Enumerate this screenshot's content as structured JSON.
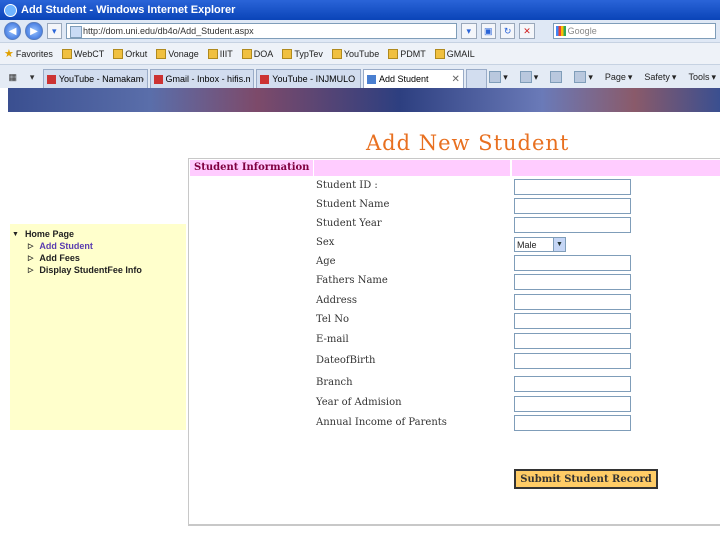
{
  "window": {
    "title": "Add Student - Windows Internet Explorer"
  },
  "address_bar": {
    "url": "http://dom.uni.edu/db4o/Add_Student.aspx",
    "search_placeholder": "Google"
  },
  "favorites_bar": {
    "favorites_label": "Favorites",
    "items": [
      "WebCT",
      "Orkut",
      "Vonage",
      "IIIT",
      "DOA",
      "TypTev",
      "YouTube",
      "PDMT",
      "GMAIL"
    ]
  },
  "tabs": [
    {
      "label": "YouTube - Namakame ...",
      "active": false
    },
    {
      "label": "Gmail - Inbox - hifis.m...",
      "active": false
    },
    {
      "label": "YouTube - INJMULO H...",
      "active": false
    },
    {
      "label": "Add Student",
      "active": true
    }
  ],
  "command_bar": {
    "page": "Page",
    "safety": "Safety",
    "tools": "Tools"
  },
  "page": {
    "heading": "Add New Student",
    "sidebar": {
      "root": "Home Page",
      "items": [
        "Add Student",
        "Add Fees",
        "Display StudentFee Info"
      ]
    },
    "form": {
      "section_title": "Student Information",
      "fields": [
        "Student ID :",
        "Student Name",
        "Student Year",
        "Sex",
        "Age",
        "Fathers Name",
        "Address",
        "Tel No",
        "E-mail",
        "DateofBirth",
        "Branch",
        "Year of Admision",
        "Annual Income of Parents"
      ],
      "sex_selected": "Male",
      "submit_label": "Submit Student Record"
    }
  },
  "colors": {
    "heading": "#e87020",
    "sidebar_bg": "#ffffcc",
    "section_header_bg": "#ffccff",
    "submit_bg": "#ffcc66"
  }
}
